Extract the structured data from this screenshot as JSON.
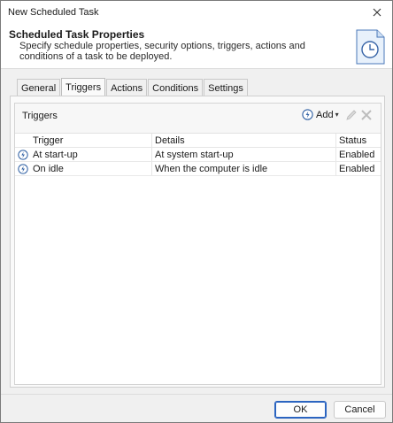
{
  "window": {
    "title": "New Scheduled Task",
    "close_icon": "close-icon"
  },
  "header": {
    "title": "Scheduled Task Properties",
    "subtitle": "Specify schedule properties, security options, triggers, actions and conditions of a task to be deployed.",
    "icon": "clock-document-icon"
  },
  "tabs": [
    {
      "label": "General",
      "active": false
    },
    {
      "label": "Triggers",
      "active": true
    },
    {
      "label": "Actions",
      "active": false
    },
    {
      "label": "Conditions",
      "active": false
    },
    {
      "label": "Settings",
      "active": false
    }
  ],
  "triggers_panel": {
    "title": "Triggers",
    "add_label": "Add",
    "columns": [
      "Trigger",
      "Details",
      "Status"
    ],
    "rows": [
      {
        "trigger": "At start-up",
        "details": "At system start-up",
        "status": "Enabled",
        "icon": "trigger-icon"
      },
      {
        "trigger": "On idle",
        "details": "When the computer is idle",
        "status": "Enabled",
        "icon": "trigger-icon"
      }
    ]
  },
  "footer": {
    "ok_label": "OK",
    "cancel_label": "Cancel"
  },
  "colors": {
    "accent": "#2b64c0",
    "header_bg": "#ffffff",
    "window_bg": "#f0f0f0"
  }
}
